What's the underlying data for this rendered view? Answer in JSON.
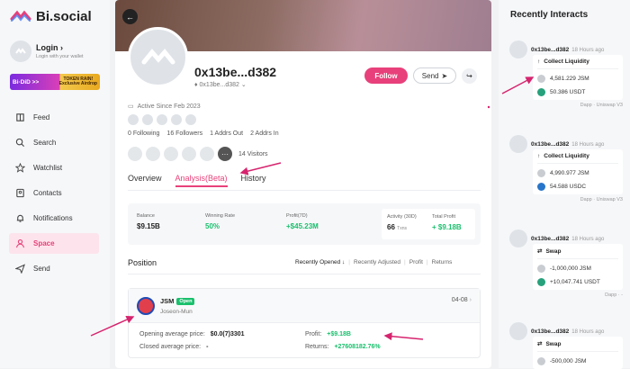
{
  "sidebar": {
    "logo_text": "Bi.social",
    "login_title": "Login ›",
    "login_sub": "Login with your wallet",
    "banner_left": "Bi·DiD >>",
    "banner_right_1": "TOKEN RAIN!",
    "banner_right_2": "Exclusive Airdrop",
    "items": [
      {
        "label": "Feed",
        "icon": "book-icon"
      },
      {
        "label": "Search",
        "icon": "search-icon"
      },
      {
        "label": "Watchlist",
        "icon": "star-icon"
      },
      {
        "label": "Contacts",
        "icon": "contacts-icon"
      },
      {
        "label": "Notifications",
        "icon": "bell-icon"
      },
      {
        "label": "Space",
        "icon": "person-icon",
        "active": true
      },
      {
        "label": "Send",
        "icon": "send-icon"
      }
    ]
  },
  "profile": {
    "address": "0x13be...d382",
    "address_sub": "0x13be...d382",
    "follow_label": "Follow",
    "send_label": "Send",
    "active_since": "Active Since Feb 2023",
    "following": "0 Following",
    "followers": "16 Followers",
    "addrs_out": "1 Addrs Out",
    "addrs_in": "2 Addrs In",
    "visitors": "14 Visitors"
  },
  "tabs": [
    "Overview",
    "Analysis(Beta)",
    "History"
  ],
  "summary": {
    "balance_label": "Balance",
    "balance": "$9.15B",
    "winrate_label": "Winning Rate",
    "winrate": "50%",
    "profit7d_label": "Profit(7D)",
    "profit7d": "+$45.23M",
    "activity_label": "Activity (30D)",
    "activity": "66",
    "activity_unit": "Txns",
    "total_profit_label": "Total Profit",
    "total_profit": "+ $9.18B"
  },
  "position": {
    "title": "Position",
    "filters": [
      "Recently Opened ↓",
      "Recently Adjusted",
      "Profit",
      "Returns"
    ],
    "token": "JSM",
    "badge": "Open",
    "token_sub": "Joseon-Mun",
    "date": "04-08",
    "open_price_label": "Opening average price:",
    "open_price": "$0.0(7)3301",
    "close_price_label": "Closed average price:",
    "close_price": "-",
    "profit_label": "Profit:",
    "profit": "+$9.18B",
    "returns_label": "Returns:",
    "returns": "+27608182.76%"
  },
  "recent": {
    "title": "Recently Interacts",
    "items": [
      {
        "addr": "0x13be...d382",
        "time": "18 Hours ago",
        "action": "Collect Liquidity",
        "l1": "4,581.229 JSM",
        "l2": "50.386 USDT",
        "dapp": "Dapp",
        "dapp_name": "Uniswap V3",
        "c2": "#26a17b"
      },
      {
        "addr": "0x13be...d382",
        "time": "18 Hours ago",
        "action": "Collect Liquidity",
        "l1": "4,990.977 JSM",
        "l2": "54.588 USDC",
        "dapp": "Dapp",
        "dapp_name": "Uniswap V3",
        "c2": "#2775ca"
      },
      {
        "addr": "0x13be...d382",
        "time": "18 Hours ago",
        "action": "Swap",
        "l1": "-1,000,000 JSM",
        "l2": "+10,047.741 USDT",
        "dapp": "Dapp",
        "dapp_name": "-",
        "c2": "#26a17b"
      },
      {
        "addr": "0x13be...d382",
        "time": "18 Hours ago",
        "action": "Swap",
        "l1": "-500,000 JSM",
        "l2": "",
        "dapp": "",
        "dapp_name": "",
        "c2": "#26a17b"
      }
    ]
  },
  "colors": {
    "accent": "#e8407a",
    "green": "#1ac06d",
    "annotation": "#d6246e"
  }
}
